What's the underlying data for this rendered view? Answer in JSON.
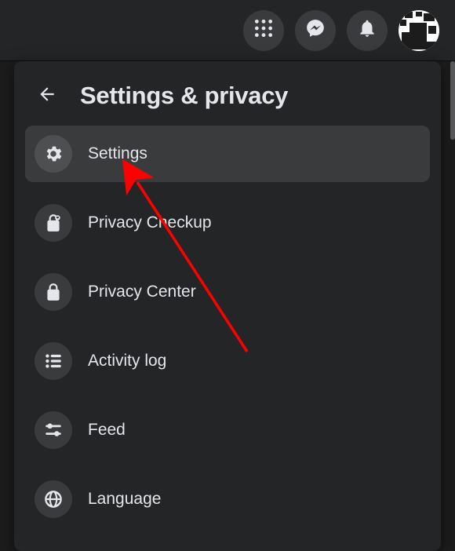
{
  "header": {
    "title": "Settings & privacy"
  },
  "menu": {
    "items": [
      {
        "label": "Settings",
        "icon": "gear",
        "highlighted": true
      },
      {
        "label": "Privacy Checkup",
        "icon": "lock-heart",
        "highlighted": false
      },
      {
        "label": "Privacy Center",
        "icon": "lock",
        "highlighted": false
      },
      {
        "label": "Activity log",
        "icon": "list",
        "highlighted": false
      },
      {
        "label": "Feed",
        "icon": "sliders",
        "highlighted": false
      },
      {
        "label": "Language",
        "icon": "globe",
        "highlighted": false
      }
    ]
  },
  "annotation": {
    "arrow_color": "#ff0000",
    "points_to": "Settings"
  }
}
